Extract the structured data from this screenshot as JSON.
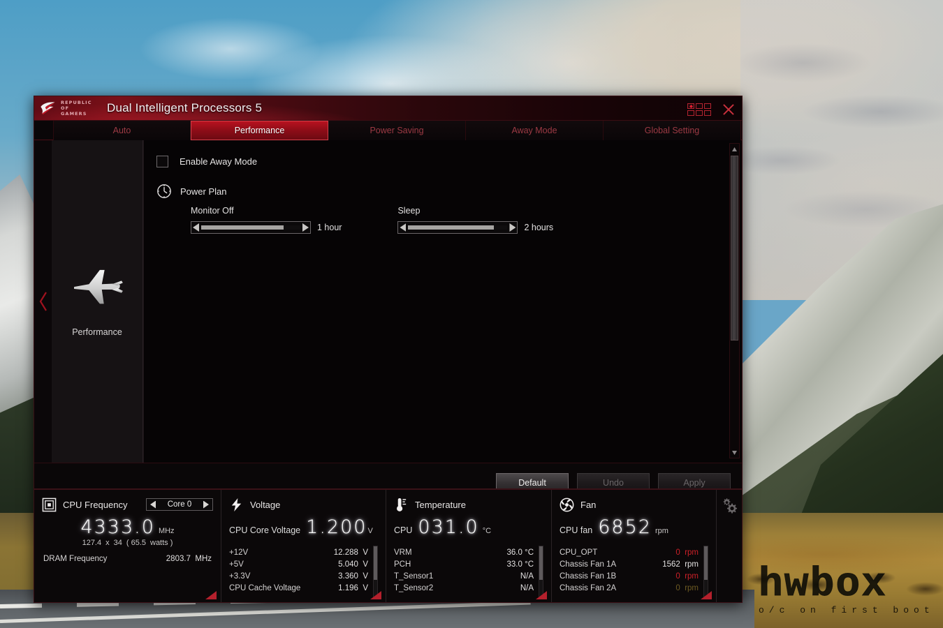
{
  "window": {
    "brand_line1": "REPUBLIC OF",
    "brand_line2": "GAMERS",
    "title": "Dual Intelligent Processors 5",
    "controls": {
      "grid_name": "grid-layout-button",
      "close_name": "close-button"
    }
  },
  "tabs": [
    {
      "label": "Auto",
      "active": false
    },
    {
      "label": "Performance",
      "active": true
    },
    {
      "label": "Power Saving",
      "active": false
    },
    {
      "label": "Away Mode",
      "active": false
    },
    {
      "label": "Global Setting",
      "active": false
    }
  ],
  "sidebar": {
    "mode_label": "Performance",
    "icon": "airplane-icon",
    "collapse_icon": "chevron-left-icon"
  },
  "content": {
    "enable_away_mode": {
      "label": "Enable Away Mode",
      "checked": false
    },
    "power_plan": {
      "label": "Power Plan",
      "icon": "clock-icon",
      "sliders": [
        {
          "title": "Monitor Off",
          "value": "1 hour",
          "fill_percent": 83
        },
        {
          "title": "Sleep",
          "value": "2 hours",
          "fill_percent": 86
        }
      ]
    }
  },
  "actions": [
    {
      "label": "Default",
      "enabled": true
    },
    {
      "label": "Undo",
      "enabled": false
    },
    {
      "label": "Apply",
      "enabled": false
    }
  ],
  "monitor": {
    "cpu_frequency": {
      "icon": "cpu-chip-icon",
      "title": "CPU Frequency",
      "core_selector": "Core 0",
      "big_value": "4333.0",
      "big_unit": "MHz",
      "sub_bclk": "127.4",
      "sub_x": "x",
      "sub_multiplier": "34",
      "sub_watts": "( 65.5",
      "sub_watts_unit": "watts )",
      "dram_label": "DRAM Frequency",
      "dram_value": "2803.7",
      "dram_unit": "MHz"
    },
    "voltage": {
      "icon": "lightning-bolt-icon",
      "title": "Voltage",
      "lead_label": "CPU Core Voltage",
      "big_value": "1.200",
      "big_unit": "V",
      "rows": [
        {
          "name": "+12V",
          "value": "12.288  V",
          "color": "normal"
        },
        {
          "name": "+5V",
          "value": "5.040  V",
          "color": "normal"
        },
        {
          "name": "+3.3V",
          "value": "3.360  V",
          "color": "normal"
        },
        {
          "name": "CPU Cache Voltage",
          "value": "1.196  V",
          "color": "normal"
        }
      ]
    },
    "temperature": {
      "icon": "thermometer-icon",
      "title": "Temperature",
      "lead_label": "CPU",
      "big_value": "031.0",
      "big_unit": "°C",
      "rows": [
        {
          "name": "VRM",
          "value": "36.0 °C",
          "color": "normal"
        },
        {
          "name": "PCH",
          "value": "33.0 °C",
          "color": "normal"
        },
        {
          "name": "T_Sensor1",
          "value": "N/A",
          "color": "normal"
        },
        {
          "name": "T_Sensor2",
          "value": "N/A",
          "color": "normal"
        }
      ]
    },
    "fan": {
      "icon": "fan-icon",
      "title": "Fan",
      "lead_label": "CPU fan",
      "big_value": "6852",
      "big_unit": "rpm",
      "rows": [
        {
          "name": "CPU_OPT",
          "value": "0  rpm",
          "color": "red"
        },
        {
          "name": "Chassis Fan 1A",
          "value": "1562  rpm",
          "color": "normal"
        },
        {
          "name": "Chassis Fan 1B",
          "value": "0  rpm",
          "color": "red"
        },
        {
          "name": "Chassis Fan 2A",
          "value": "0  rpm",
          "color": "dim"
        }
      ]
    },
    "settings_icon": "gears-icon"
  },
  "watermark": {
    "main": "hwbox",
    "sub": "o/c on first boot"
  },
  "colors": {
    "accent_red": "#b8121f",
    "window_bg": "#080607",
    "panel_bg": "#0b0809",
    "value_red": "#cc2028"
  }
}
